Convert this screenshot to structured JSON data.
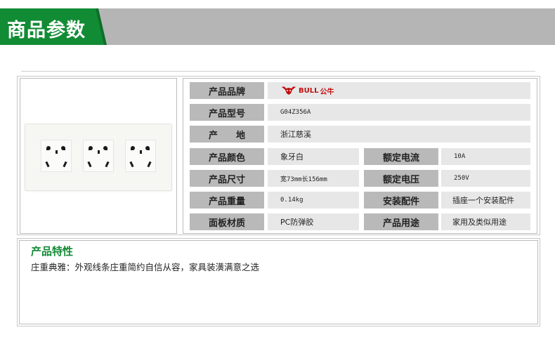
{
  "header": {
    "title": "商品参数",
    "accent": "#128b35"
  },
  "params": {
    "rows": [
      {
        "label": "产品品牌",
        "value": ""
      },
      {
        "label": "产品型号",
        "value": "G04Z356A"
      },
      {
        "label": "产　　地",
        "value": "浙江慈溪"
      },
      {
        "label": "产品颜色",
        "value": "象牙白"
      },
      {
        "label": "产品尺寸",
        "value": "宽73mm长156mm"
      },
      {
        "label": "产品重量",
        "value": "0.14kg"
      },
      {
        "label": "面板材质",
        "value": "PC防弹胶"
      }
    ],
    "right_rows": [
      {
        "label": "额定电流",
        "value": "10A"
      },
      {
        "label": "额定电压",
        "value": "250V"
      },
      {
        "label": "安装配件",
        "value": "插座一个安装配件"
      },
      {
        "label": "产品用途",
        "value": "家用及类似用途"
      }
    ],
    "brand": {
      "text": "BULL",
      "cn": "公牛",
      "color": "#c01010"
    }
  },
  "features": {
    "title": "产品特性",
    "text": "庄重典雅：外观线条庄重简约自信从容，家具装潢满意之选"
  }
}
